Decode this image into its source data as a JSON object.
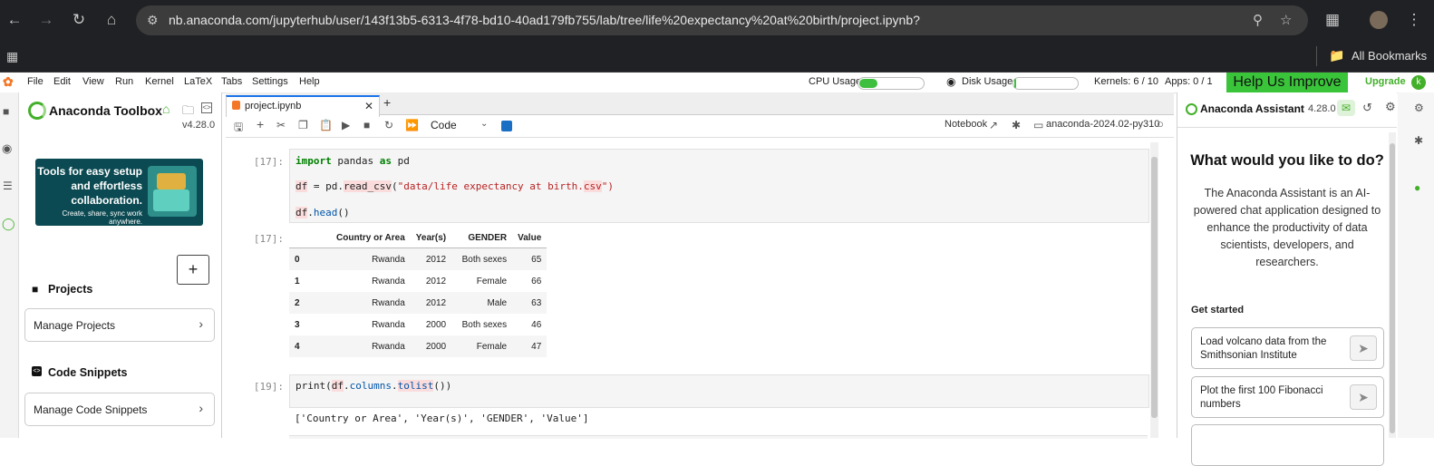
{
  "browser": {
    "url": "nb.anaconda.com/jupyterhub/user/143f13b5-6313-4f78-bd10-40ad179fb755/lab/tree/life%20expectancy%20at%20birth/project.ipynb?",
    "bookmarks_label": "All Bookmarks"
  },
  "menu": {
    "items": [
      "File",
      "Edit",
      "View",
      "Run",
      "Kernel",
      "LaTeX",
      "Tabs",
      "Settings",
      "Help"
    ],
    "cpu_label": "CPU Usage",
    "cpu_fraction": 0.28,
    "disk_label": "Disk Usage",
    "disk_fraction": 0.03,
    "kernels": "Kernels: 6 / 10",
    "apps": "Apps: 0 / 1",
    "help_improve": "Help Us Improve",
    "upgrade": "Upgrade",
    "avatar_letter": "k"
  },
  "toolbox": {
    "title": "Anaconda Toolbox",
    "version": "v4.28.0",
    "banner_title": "Tools for easy setup and effortless collaboration.",
    "banner_sub": "Create, share, sync work anywhere.",
    "add_symbol": "+",
    "projects_heading": "Projects",
    "manage_projects": "Manage Projects",
    "snippets_heading": "Code Snippets",
    "manage_snippets": "Manage Code Snippets"
  },
  "notebook": {
    "tab_name": "project.ipynb",
    "cell_type": "Code",
    "notebook_label": "Notebook",
    "kernel_name": "anaconda-2024.02-py310",
    "cell1": {
      "prompt": "[17]:",
      "in_prompt_out": "[17]:",
      "line1_kw1": "import",
      "line1_mid": " pandas ",
      "line1_kw2": "as",
      "line1_end": " pd",
      "line2_a": "df",
      "line2_b": " = pd.",
      "line2_c": "read_csv",
      "line2_d": "(",
      "line2_e": "\"data/life expectancy at birth.",
      "line2_f": "csv",
      "line2_g": "\")",
      "line3_a": "df",
      "line3_b": ".",
      "line3_c": "head",
      "line3_d": "()"
    },
    "table": {
      "columns": [
        "",
        "Country or Area",
        "Year(s)",
        "GENDER",
        "Value"
      ],
      "rows": [
        [
          "0",
          "Rwanda",
          "2012",
          "Both sexes",
          "65"
        ],
        [
          "1",
          "Rwanda",
          "2012",
          "Female",
          "66"
        ],
        [
          "2",
          "Rwanda",
          "2012",
          "Male",
          "63"
        ],
        [
          "3",
          "Rwanda",
          "2000",
          "Both sexes",
          "46"
        ],
        [
          "4",
          "Rwanda",
          "2000",
          "Female",
          "47"
        ]
      ]
    },
    "cell2": {
      "prompt": "[19]:",
      "code_a": "print(",
      "code_b": "df",
      "code_c": ".",
      "code_d": "columns",
      "code_e": ".",
      "code_f": "tolist",
      "code_g": "())",
      "output": "['Country or Area', 'Year(s)', 'GENDER', 'Value']"
    }
  },
  "assistant": {
    "title": "Anaconda Assistant",
    "version": "4.28.0",
    "heading": "What would you like to do?",
    "description": "The Anaconda Assistant is an AI-powered chat application designed to enhance the productivity of data scientists, developers, and researchers.",
    "get_started": "Get started",
    "prompts": [
      "Load volcano data from the Smithsonian Institute",
      "Plot the first 100 Fibonacci numbers"
    ]
  },
  "colors": {
    "accent_green": "#43b02a",
    "help_green": "#39c439",
    "chrome_dark": "#202124"
  }
}
